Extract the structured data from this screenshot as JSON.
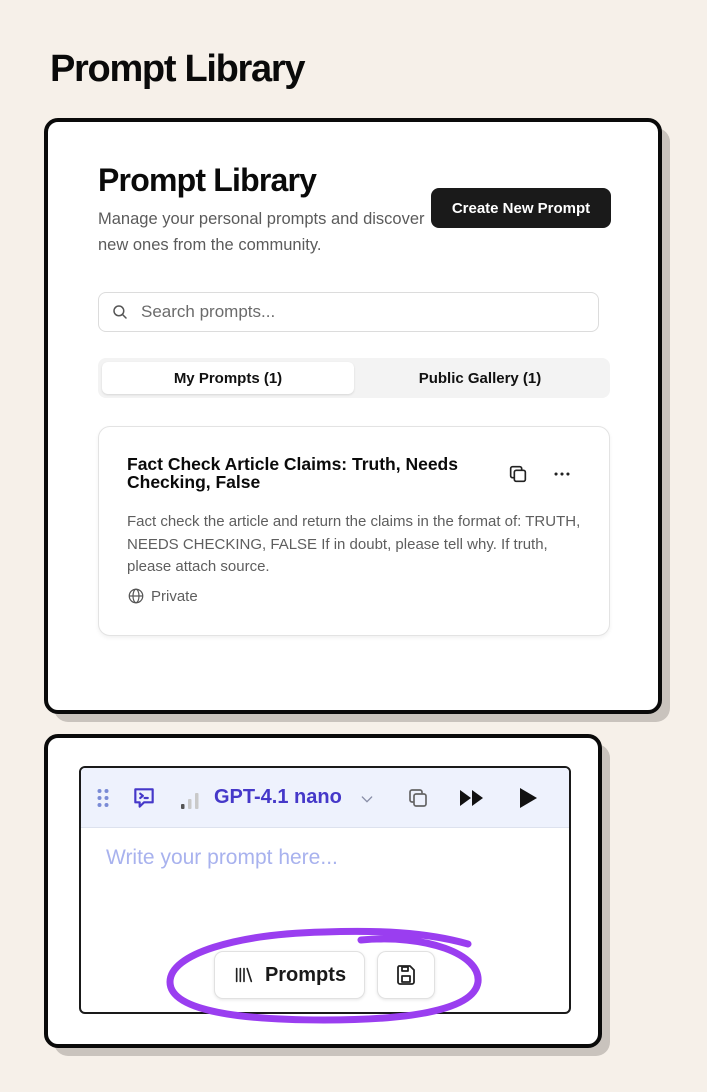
{
  "page": {
    "heading": "Prompt Library"
  },
  "library": {
    "title": "Prompt Library",
    "subtitle": "Manage your personal prompts and discover new ones from the community.",
    "create_button": "Create New Prompt",
    "search": {
      "placeholder": "Search prompts...",
      "value": ""
    },
    "tabs": [
      {
        "label": "My Prompts (1)",
        "active": true
      },
      {
        "label": "Public Gallery (1)",
        "active": false
      }
    ],
    "cards": [
      {
        "title": "Fact Check Article Claims: Truth, Needs Checking, False",
        "description": "Fact check the article and return the claims in the format of: TRUTH, NEEDS CHECKING, FALSE If in doubt, please tell why. If truth, please attach source.",
        "visibility": "Private"
      }
    ]
  },
  "editor": {
    "model": "GPT-4.1 nano",
    "placeholder": "Write your prompt here...",
    "value": "",
    "prompts_button": "Prompts"
  },
  "colors": {
    "background": "#f6f0e9",
    "model_accent": "#4538c9",
    "placeholder": "#a8b2ee",
    "toolbar_bg": "#eef2fd",
    "highlight": "#9a3ef0"
  },
  "icons": {
    "search": "search-icon",
    "copy": "copy-icon",
    "more": "more-horizontal-icon",
    "visibility": "globe-icon",
    "drag": "drag-handle-icon",
    "chat": "chat-code-icon",
    "signal": "signal-bars-icon",
    "dropdown": "chevron-down-icon",
    "run_all": "fast-forward-icon",
    "run": "play-icon",
    "library": "library-icon",
    "save": "save-icon"
  }
}
